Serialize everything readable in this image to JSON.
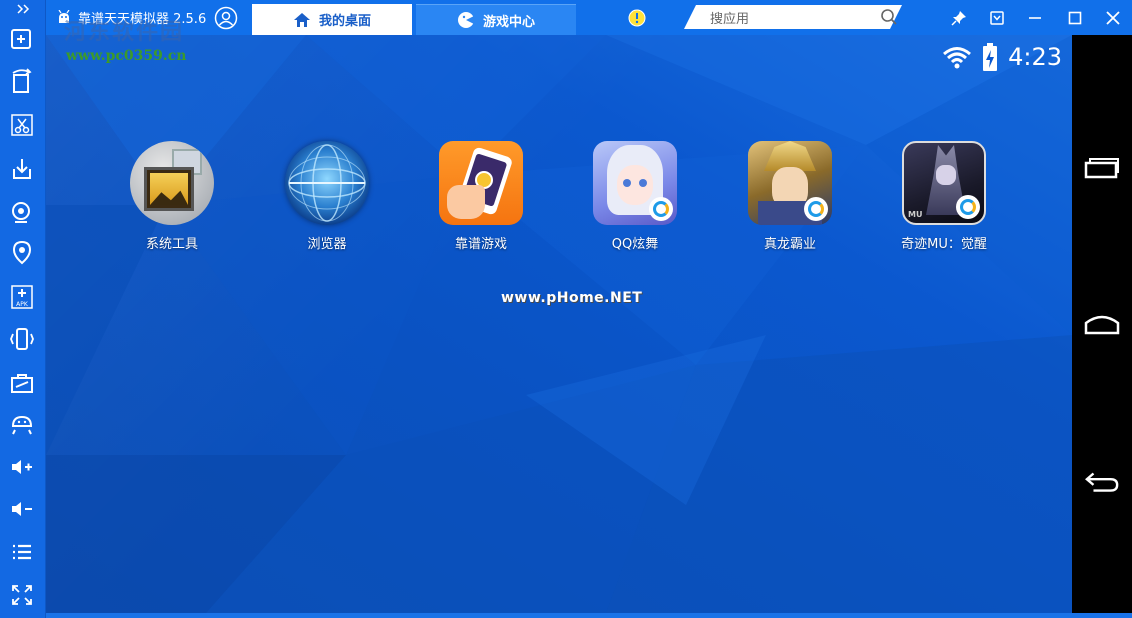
{
  "titlebar": {
    "app_title": "靠谱天天模拟器 2.5.6",
    "tabs": [
      {
        "label": "我的桌面",
        "icon": "home-icon"
      },
      {
        "label": "游戏中心",
        "icon": "gamepad-icon"
      }
    ],
    "search_placeholder": "搜应用"
  },
  "watermark": {
    "site_name": "河东软件园",
    "url": "www.pc0359.cn",
    "center": "www.pHome.NET"
  },
  "status": {
    "time": "4:23"
  },
  "apps": [
    {
      "label": "系统工具",
      "icon": "system-tools-icon"
    },
    {
      "label": "浏览器",
      "icon": "browser-globe-icon"
    },
    {
      "label": "靠谱游戏",
      "icon": "kaopu-game-icon"
    },
    {
      "label": "QQ炫舞",
      "icon": "qq-dance-icon"
    },
    {
      "label": "真龙霸业",
      "icon": "dragon-hero-icon"
    },
    {
      "label": "奇迹MU：觉醒",
      "icon": "mu-awakening-icon"
    }
  ],
  "colors": {
    "titlebar": "#1170ea",
    "desktop": "#0b58cf",
    "accent": "#2a86f3"
  }
}
